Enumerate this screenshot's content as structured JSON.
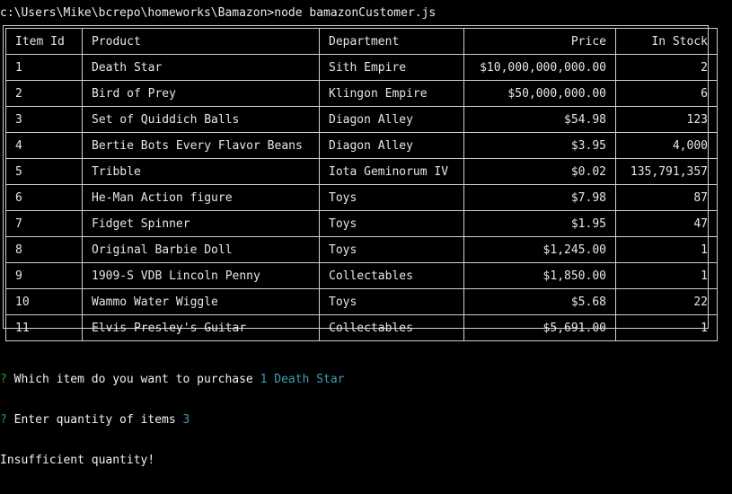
{
  "terminal": {
    "command": "c:\\Users\\Mike\\bcrepo\\homeworks\\Bamazon>node bamazonCustomer.js"
  },
  "table": {
    "headers": {
      "id": "Item Id",
      "product": "Product",
      "department": "Department",
      "price": "Price",
      "stock": "In Stock"
    },
    "rows": [
      {
        "id": "1",
        "product": "Death Star",
        "department": "Sith Empire",
        "price": "$10,000,000,000.00",
        "stock": "2"
      },
      {
        "id": "2",
        "product": "Bird of Prey",
        "department": "Klingon Empire",
        "price": "$50,000,000.00",
        "stock": "6"
      },
      {
        "id": "3",
        "product": "Set of Quiddich Balls",
        "department": "Diagon Alley",
        "price": "$54.98",
        "stock": "123"
      },
      {
        "id": "4",
        "product": "Bertie Bots Every Flavor Beans",
        "department": "Diagon Alley",
        "price": "$3.95",
        "stock": "4,000"
      },
      {
        "id": "5",
        "product": "Tribble",
        "department": "Iota Geminorum IV",
        "price": "$0.02",
        "stock": "135,791,357"
      },
      {
        "id": "6",
        "product": "He-Man Action figure",
        "department": "Toys",
        "price": "$7.98",
        "stock": "87"
      },
      {
        "id": "7",
        "product": "Fidget Spinner",
        "department": "Toys",
        "price": "$1.95",
        "stock": "47"
      },
      {
        "id": "8",
        "product": "Original Barbie Doll",
        "department": "Toys",
        "price": "$1,245.00",
        "stock": "1"
      },
      {
        "id": "9",
        "product": "1909-S VDB Lincoln Penny",
        "department": "Collectables",
        "price": "$1,850.00",
        "stock": "1"
      },
      {
        "id": "10",
        "product": "Wammo Water Wiggle",
        "department": "Toys",
        "price": "$5.68",
        "stock": "22"
      },
      {
        "id": "11",
        "product": "Elvis Presley's Guitar",
        "department": "Collectables",
        "price": "$5,691.00",
        "stock": "1"
      }
    ]
  },
  "prompts": [
    {
      "marker": "?",
      "question": "Which item do you want to purchase",
      "answer": "1 Death Star"
    },
    {
      "marker": "?",
      "question": "Enter quantity of items",
      "answer": "3"
    }
  ],
  "result": "Insufficient quantity!",
  "colors": {
    "background": "#000000",
    "text": "#e6e6e6",
    "prompt_marker": "#2a9a3a",
    "answer": "#3aa0b0",
    "border": "#cfcfcf"
  }
}
